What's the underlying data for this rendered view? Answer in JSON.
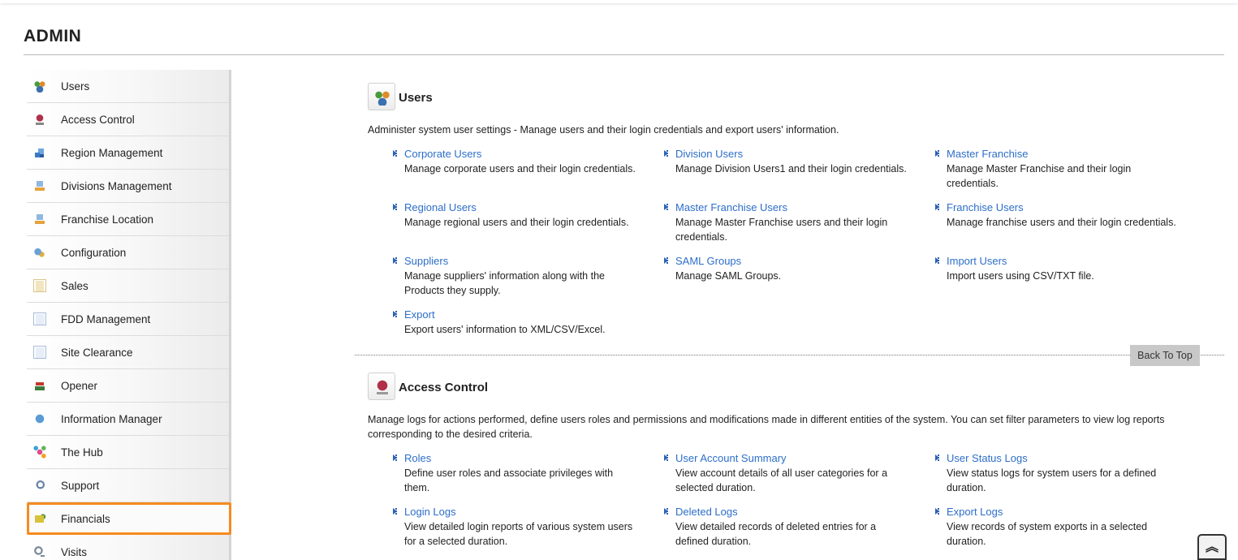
{
  "page": {
    "title": "ADMIN"
  },
  "sidebar": {
    "items": [
      {
        "label": "Users",
        "icon": "users-icon"
      },
      {
        "label": "Access Control",
        "icon": "access-control-icon"
      },
      {
        "label": "Region Management",
        "icon": "region-icon"
      },
      {
        "label": "Divisions Management",
        "icon": "divisions-icon"
      },
      {
        "label": "Franchise Location",
        "icon": "franchise-location-icon"
      },
      {
        "label": "Configuration",
        "icon": "configuration-icon"
      },
      {
        "label": "Sales",
        "icon": "sales-icon"
      },
      {
        "label": "FDD Management",
        "icon": "fdd-icon"
      },
      {
        "label": "Site Clearance",
        "icon": "site-clearance-icon"
      },
      {
        "label": "Opener",
        "icon": "opener-icon"
      },
      {
        "label": "Information Manager",
        "icon": "information-manager-icon"
      },
      {
        "label": "The Hub",
        "icon": "hub-icon"
      },
      {
        "label": "Support",
        "icon": "support-icon"
      },
      {
        "label": "Financials",
        "icon": "financials-icon",
        "selected": true
      },
      {
        "label": "Visits",
        "icon": "visits-icon"
      }
    ],
    "selected_color": "#f68b1f"
  },
  "sections": {
    "users": {
      "title": "Users",
      "description": "Administer system user settings - Manage users and their login credentials and export users' information.",
      "links": [
        {
          "label": "Corporate Users",
          "desc": "Manage corporate users and their login credentials."
        },
        {
          "label": "Division Users",
          "desc": "Manage Division Users1 and their login credentials."
        },
        {
          "label": "Master Franchise",
          "desc": "Manage Master Franchise and their login credentials."
        },
        {
          "label": "Regional Users",
          "desc": "Manage regional users and their login credentials."
        },
        {
          "label": "Master Franchise Users",
          "desc": "Manage Master Franchise users and their login credentials."
        },
        {
          "label": "Franchise Users",
          "desc": "Manage franchise users and their login credentials."
        },
        {
          "label": "Suppliers",
          "desc": "Manage suppliers' information along with the Products they supply."
        },
        {
          "label": "SAML Groups",
          "desc": "Manage SAML Groups."
        },
        {
          "label": "Import Users",
          "desc": "Import users using CSV/TXT file."
        },
        {
          "label": "Export",
          "desc": "Export users' information to XML/CSV/Excel."
        }
      ]
    },
    "access_control": {
      "title": "Access Control",
      "description": "Manage logs for actions performed, define users roles and permissions and modifications made in different entities of the system. You can set filter parameters to view log reports corresponding to the desired criteria.",
      "links": [
        {
          "label": "Roles",
          "desc": "Define user roles and associate privileges with them."
        },
        {
          "label": "User Account Summary",
          "desc": "View account details of all user categories for a selected duration."
        },
        {
          "label": "User Status Logs",
          "desc": "View status logs for system users for a defined duration."
        },
        {
          "label": "Login Logs",
          "desc": "View detailed login reports of various system users for a selected duration."
        },
        {
          "label": "Deleted Logs",
          "desc": "View detailed records of deleted entries for a defined duration."
        },
        {
          "label": "Export Logs",
          "desc": "View records of system exports in a selected duration."
        }
      ]
    }
  },
  "back_to_top": "Back To Top",
  "link_color": "#2d6ec9"
}
